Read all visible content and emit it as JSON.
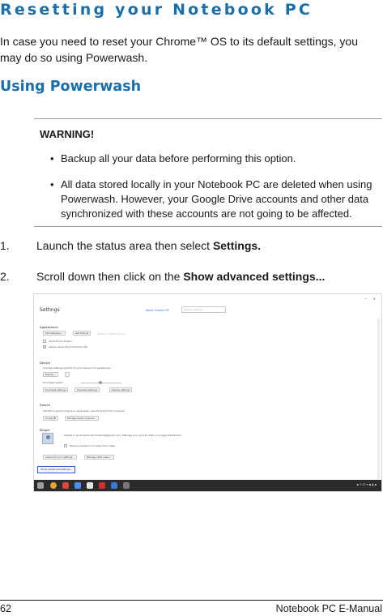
{
  "title": "Resetting your Notebook PC",
  "intro": "In case you need to reset your Chrome™ OS to its default settings, you may do so using Powerwash.",
  "subhead": "Using Powerwash",
  "warning": {
    "title": "WARNING!",
    "bullet_glyph": "•",
    "items": [
      "Backup all your data before performing this option.",
      "All data stored locally in your Notebook PC are deleted when using Powerwash. However, your Google Drive accounts and other data synchronized with these accounts are not going to be affected."
    ]
  },
  "steps": [
    {
      "num": "1.",
      "text": "Launch the status area then select ",
      "bold": "Settings."
    },
    {
      "num": "2.",
      "text": "Scroll down then click on the ",
      "bold": "Show advanced settings..."
    }
  ],
  "screenshot": {
    "window_controls": "− ✕",
    "title": "Settings",
    "about_link": "About Chrome OS",
    "search_placeholder": "Search settings",
    "appearance": {
      "heading": "Appearance",
      "set_wallpaper": "Set wallpaper...",
      "get_themes": "Get themes",
      "reset_theme": "Reset to default theme",
      "show_home": "Show Home button",
      "show_bookmarks": "Always show the bookmarks bar"
    },
    "device": {
      "heading": "Device",
      "desc": "Change settings specific to your device and peripherals.",
      "display": "Display...",
      "touchpad_speed": "Touchpad speed:",
      "touchpad_settings": "Touchpad settings",
      "keyboard_settings": "Keyboard settings",
      "display_settings": "Display settings"
    },
    "search": {
      "heading": "Search",
      "desc": "Set which search engine is used when searching from the omnibox.",
      "engine": "Google ▼",
      "manage": "Manage search engines..."
    },
    "people": {
      "heading": "People",
      "signed_in": "Signed in as asusedu.chromebook@gmail.com. Manage your synced data on Google Dashboard.",
      "require_password": "Require password to wake from sleep",
      "advanced_sync": "Advanced sync settings...",
      "manage_users": "Manage other users..."
    },
    "show_advanced": "Show advanced settings...",
    "tray_status": "▪ 7:42 ▾ ◆ ▮ ▪"
  },
  "footer": {
    "page_number": "62",
    "manual_title": "Notebook PC E-Manual"
  },
  "colors": {
    "heading_blue": "#1b6fa8",
    "link_blue": "#3367d6",
    "taskbar": "#2b2b2b"
  }
}
